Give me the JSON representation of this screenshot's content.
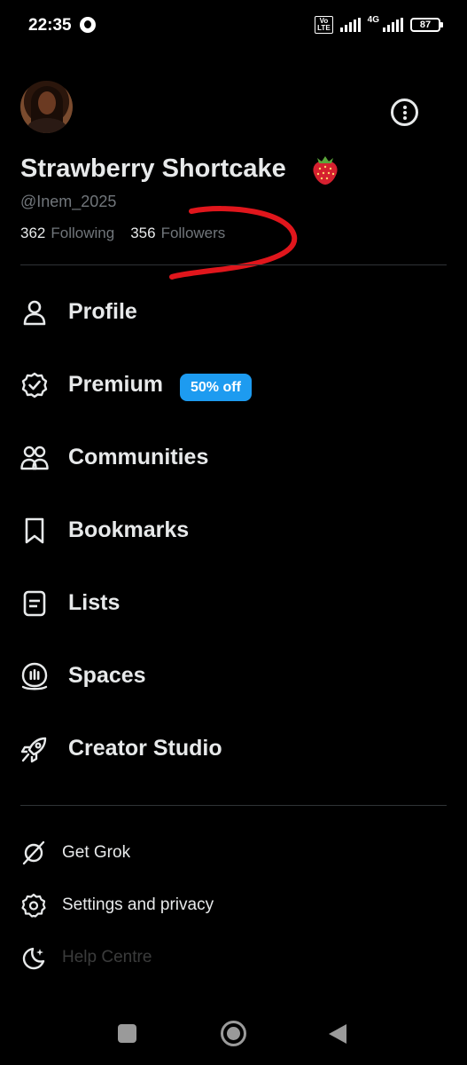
{
  "status_bar": {
    "time": "22:35",
    "volte": "Vo LTE",
    "network": "4G",
    "battery": "87"
  },
  "profile": {
    "display_name": "Strawberry Shortcake",
    "name_emoji": "strawberry-emoji",
    "handle": "@Inem_2025",
    "following_count": "362",
    "following_label": "Following",
    "followers_count": "356",
    "followers_label": "Followers"
  },
  "menu": {
    "items": [
      {
        "label": "Profile",
        "icon": "person-icon"
      },
      {
        "label": "Premium",
        "icon": "verified-badge-icon",
        "badge": "50% off"
      },
      {
        "label": "Communities",
        "icon": "people-icon"
      },
      {
        "label": "Bookmarks",
        "icon": "bookmark-icon"
      },
      {
        "label": "Lists",
        "icon": "list-icon"
      },
      {
        "label": "Spaces",
        "icon": "spaces-icon"
      },
      {
        "label": "Creator Studio",
        "icon": "rocket-icon"
      }
    ]
  },
  "secondary": {
    "items": [
      {
        "label": "Get Grok",
        "icon": "grok-icon"
      },
      {
        "label": "Settings and privacy",
        "icon": "gear-icon"
      },
      {
        "label": "Help Centre",
        "icon": "moon-icon"
      }
    ]
  },
  "colors": {
    "background": "#000000",
    "text": "#e7e9ea",
    "muted": "#71767b",
    "accent": "#1d9bf0",
    "annotation": "#e0161c"
  }
}
